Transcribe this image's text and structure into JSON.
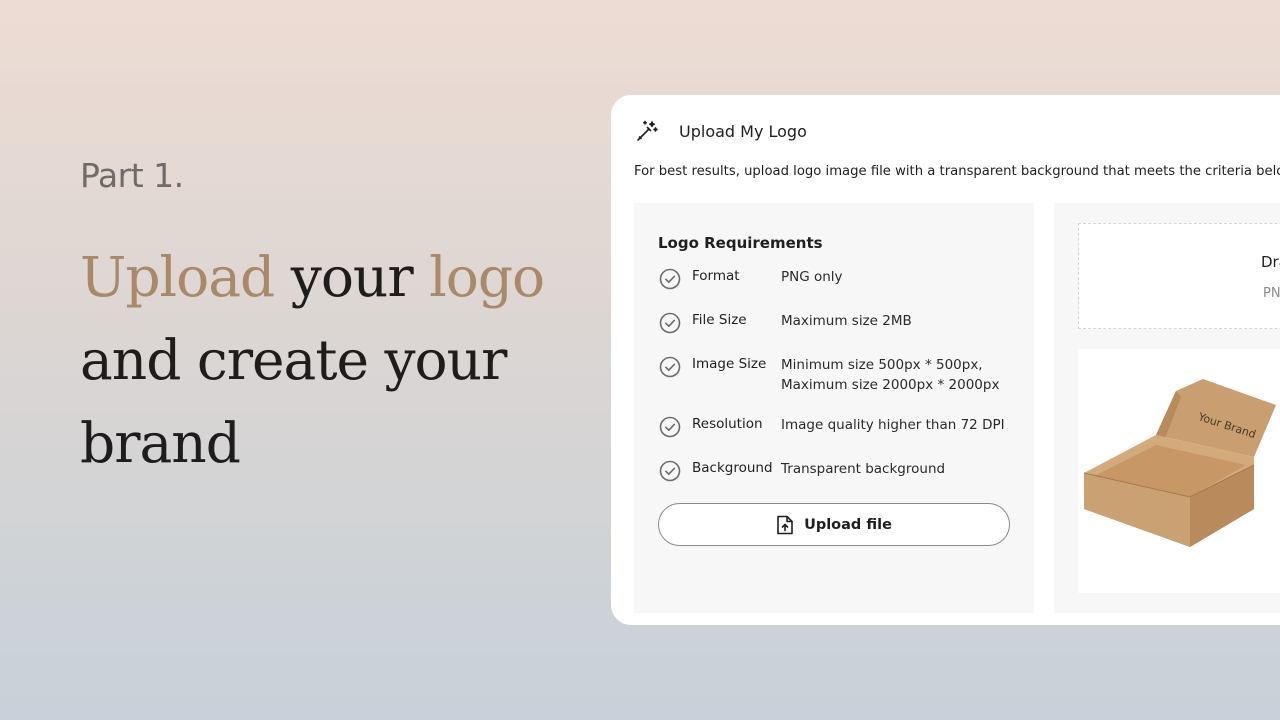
{
  "hero": {
    "part_label": "Part 1.",
    "line1_accent1": "Upload",
    "line1_mid": " your ",
    "line1_accent2": "logo",
    "line2": "and create your",
    "line3": "brand"
  },
  "card": {
    "title": "Upload My Logo",
    "description": "For best results, upload logo image file with a transparent background that meets the criteria below.",
    "requirements_title": "Logo Requirements",
    "requirements": [
      {
        "label": "Format",
        "value": "PNG only",
        "value2": ""
      },
      {
        "label": "File Size",
        "value": "Maximum size 2MB",
        "value2": ""
      },
      {
        "label": "Image Size",
        "value": "Minimum size 500px * 500px,",
        "value2": "Maximum size 2000px * 2000px"
      },
      {
        "label": "Resolution",
        "value": "Image quality higher than 72 DPI",
        "value2": ""
      },
      {
        "label": "Background",
        "value": "Transparent background",
        "value2": ""
      }
    ],
    "upload_button": "Upload file",
    "dropzone_title": "Dra",
    "dropzone_sub": "PN",
    "mockup_text": "Your Brand"
  },
  "colors": {
    "accent": "#a88a6b",
    "text_dark": "#1f1d1c",
    "panel_bg": "#f7f7f7",
    "card_bg": "#ffffff"
  },
  "icons": {
    "header": "magic-wand-icon",
    "requirement": "check-circle-icon",
    "upload": "file-upload-icon"
  }
}
